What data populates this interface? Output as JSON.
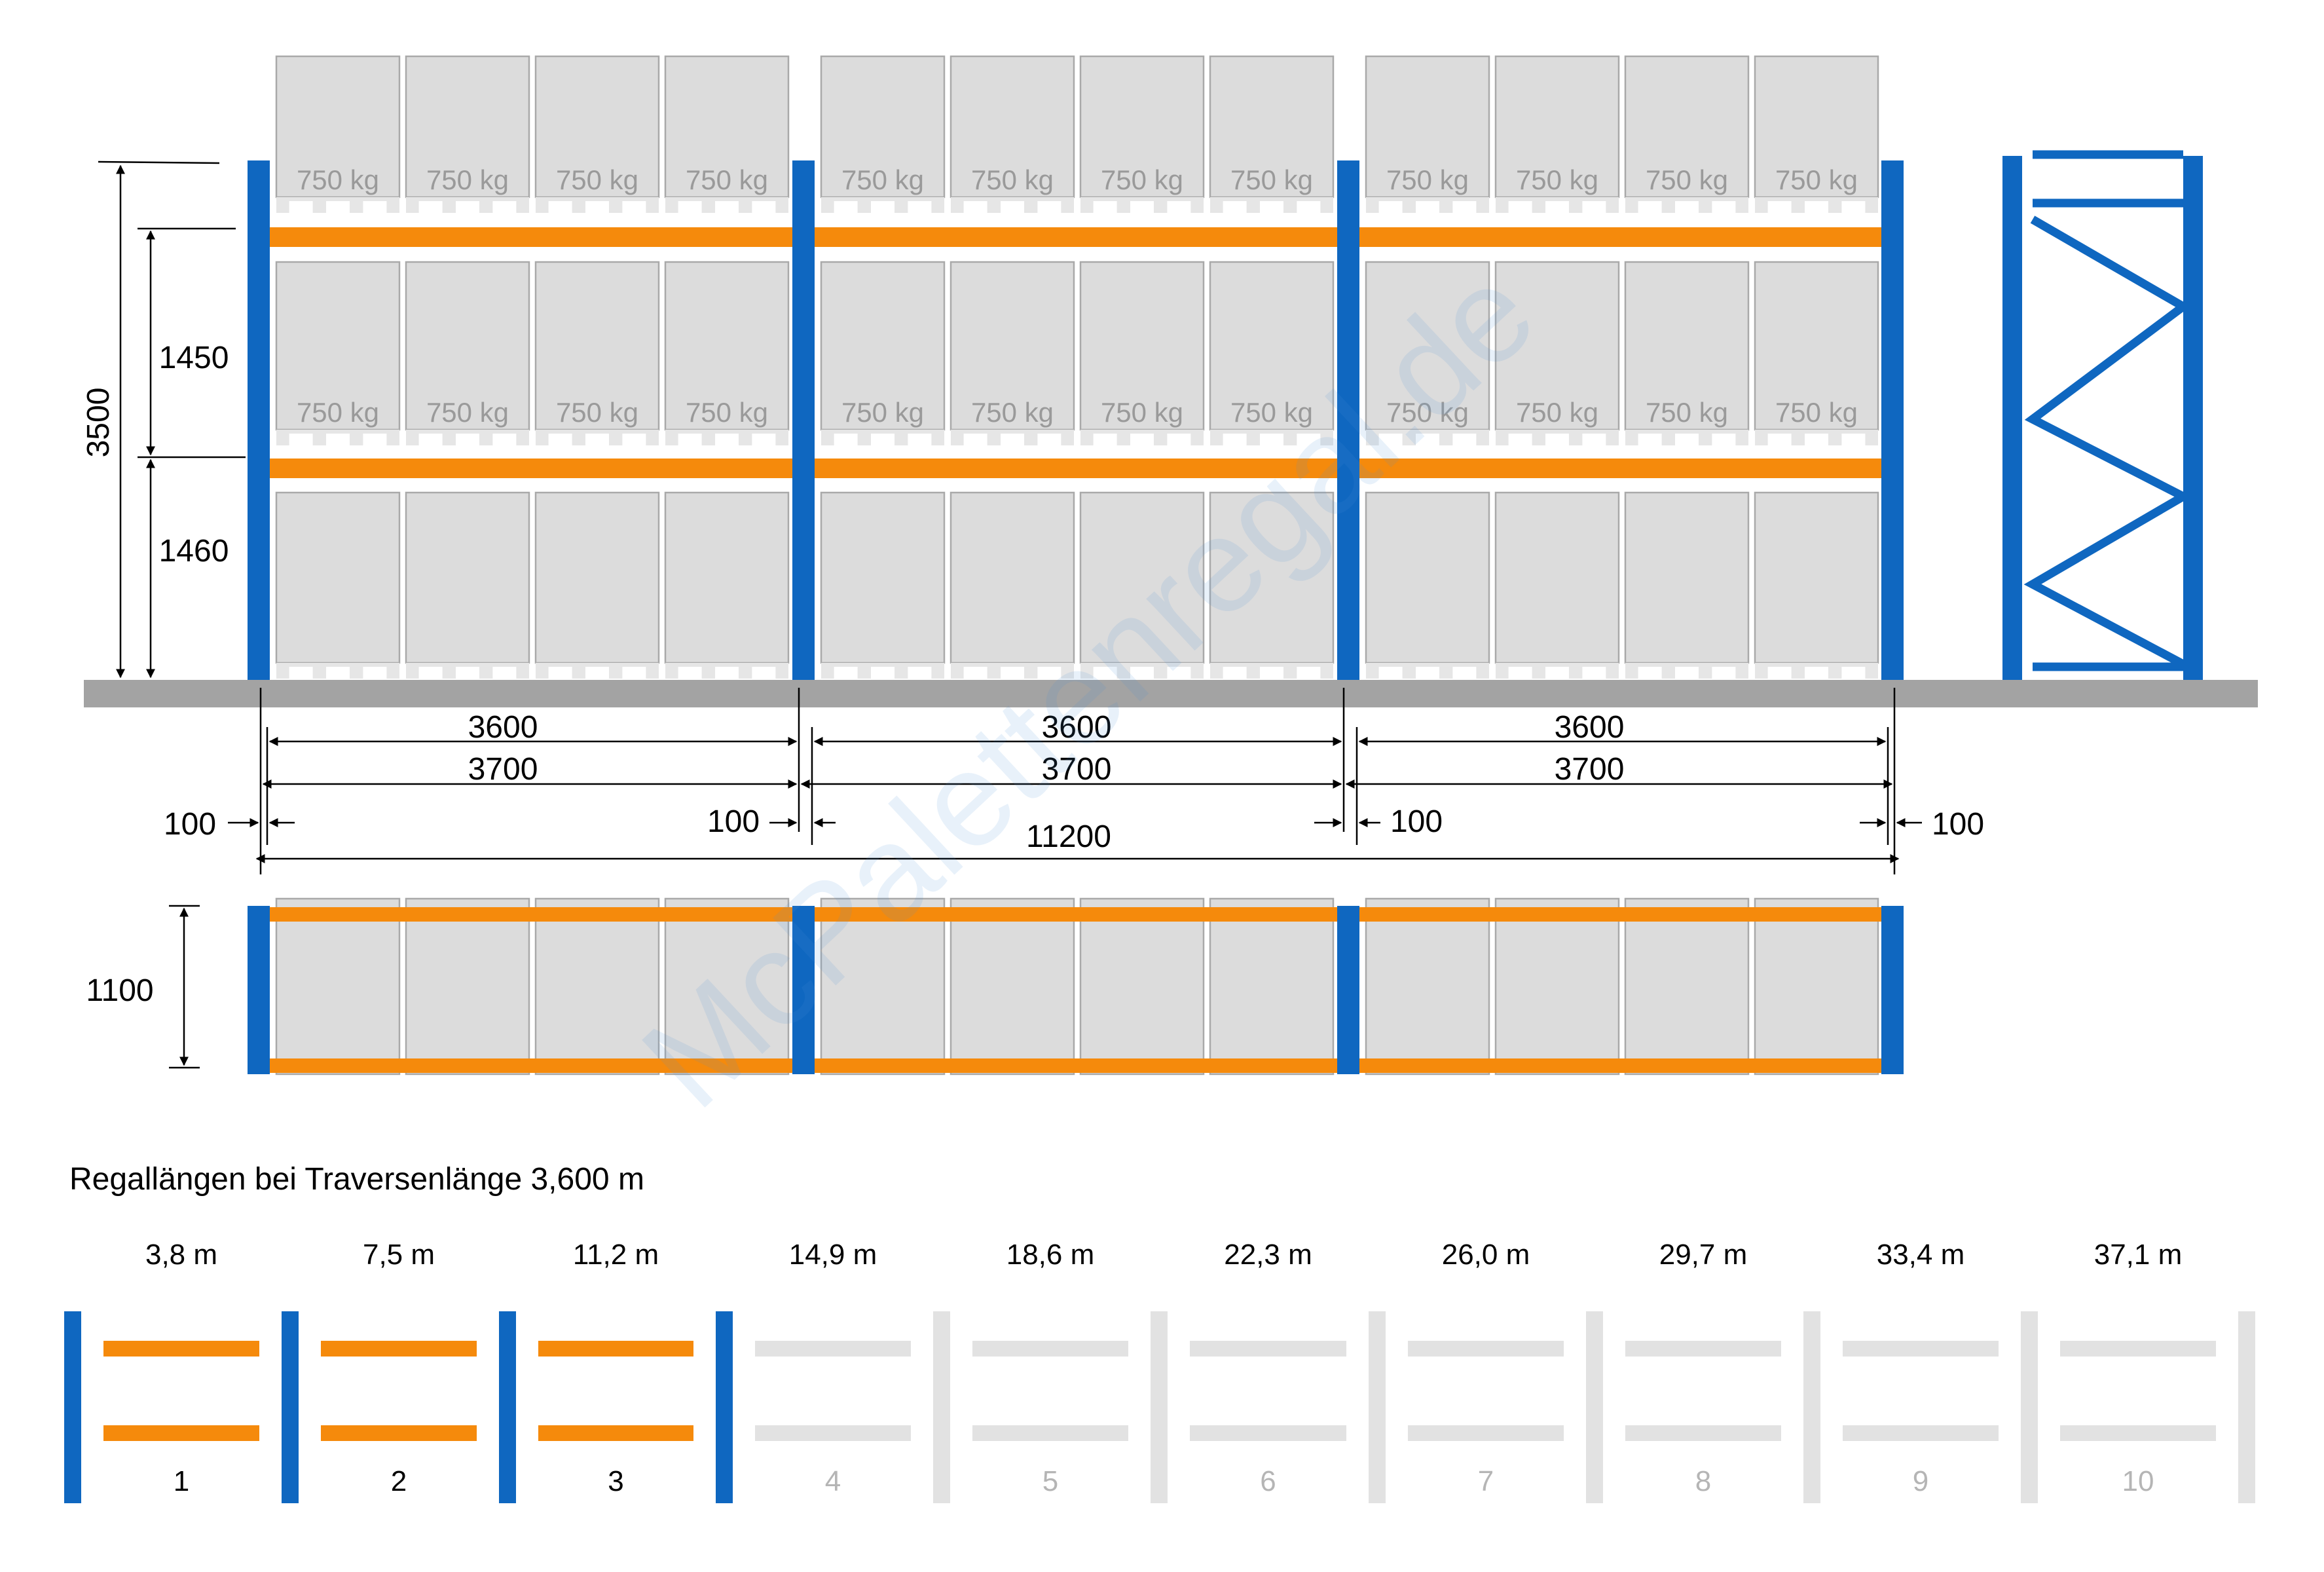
{
  "colors": {
    "upright": "#0F67C0",
    "beam": "#F58A0C",
    "pallet_fill": "#DCDCDC",
    "pallet_stroke": "#A9A9A9",
    "pallet_base": "#E6E6E6",
    "floor": "#A3A3A3",
    "inactive": "#E2E2E2",
    "dim_line": "#000000",
    "load_text": "#9A9A9A",
    "watermark": "#4A90D9"
  },
  "elevation": {
    "load_label": "750 kg",
    "bays": 3,
    "pallets_per_bay": 4
  },
  "dimensions": {
    "height_total": "3500",
    "level_upper": "1450",
    "level_lower": "1460",
    "beam_length": "3600",
    "bay_pitch": "3700",
    "upright_width": "100",
    "total_length": "11200",
    "depth": "1100"
  },
  "watermark": "McPalettenregal.de",
  "lengths_section": {
    "title": "Regallängen bei Traversenlänge 3,600 m",
    "active_count": 3,
    "items": [
      {
        "length": "3,8 m",
        "number": "1"
      },
      {
        "length": "7,5 m",
        "number": "2"
      },
      {
        "length": "11,2 m",
        "number": "3"
      },
      {
        "length": "14,9 m",
        "number": "4"
      },
      {
        "length": "18,6 m",
        "number": "5"
      },
      {
        "length": "22,3 m",
        "number": "6"
      },
      {
        "length": "26,0 m",
        "number": "7"
      },
      {
        "length": "29,7 m",
        "number": "8"
      },
      {
        "length": "33,4 m",
        "number": "9"
      },
      {
        "length": "37,1 m",
        "number": "10"
      }
    ]
  }
}
